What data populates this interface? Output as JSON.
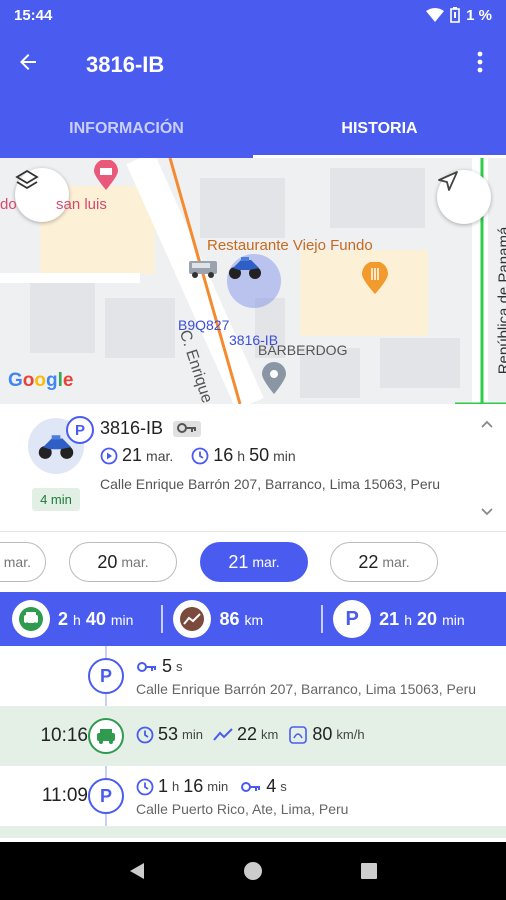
{
  "status_bar": {
    "time": "15:44",
    "battery": "1 %"
  },
  "header": {
    "title": "3816-IB"
  },
  "tabs": [
    {
      "label": "INFORMACIÓN"
    },
    {
      "label": "HISTORIA"
    }
  ],
  "map": {
    "labels": {
      "poi_left": "do",
      "poi_san_luis": "san luis",
      "restaurant": "Restaurante Viejo Fundo",
      "barberdog": "BARBERDOG",
      "street_enrique": "C. Enrique",
      "street_panama": "República de Panamá",
      "plate_b9q": "B9Q827",
      "plate_3816": "3816-IB",
      "google": "Google"
    }
  },
  "vehicle": {
    "name": "3816-IB",
    "key_icon": "key-icon",
    "date_day": "21",
    "date_month": "mar.",
    "hours": "16",
    "hours_unit": "h",
    "minutes": "50",
    "minutes_unit": "min",
    "address": "Calle Enrique Barrón 207, Barranco, Lima 15063, Peru",
    "min_badge": "4 min",
    "parking_badge": "P"
  },
  "dates": [
    {
      "day": "",
      "month": "mar."
    },
    {
      "day": "20",
      "month": "mar."
    },
    {
      "day": "21",
      "month": "mar."
    },
    {
      "day": "22",
      "month": "mar."
    }
  ],
  "summary": {
    "drive_value": "2",
    "drive_h": "h",
    "drive_min": "40",
    "drive_min_unit": "min",
    "distance_value": "86",
    "distance_unit": "km",
    "park_value": "21",
    "park_h": "h",
    "park_min": "20",
    "park_min_unit": "min",
    "park_label": "P"
  },
  "timeline": [
    {
      "time": "",
      "type": "P",
      "line1_value": "5",
      "line1_unit": "s",
      "address": "Calle Enrique Barrón 207, Barranco, Lima 15063, Peru"
    },
    {
      "time": "10:16",
      "type": "drive",
      "duration": "53",
      "duration_unit": "min",
      "distance": "22",
      "distance_unit": "km",
      "speed": "80",
      "speed_unit": "km/h"
    },
    {
      "time": "11:09",
      "type": "P",
      "hours": "1",
      "hours_unit": "h",
      "minutes": "16",
      "minutes_unit": "min",
      "key_value": "4",
      "key_unit": "s",
      "address": "Calle Puerto Rico, Ate, Lima, Peru"
    }
  ],
  "colors": {
    "primary": "#4a5cf0",
    "drive_green": "#2e9b4e",
    "drive_bg": "#e4f0e6"
  }
}
